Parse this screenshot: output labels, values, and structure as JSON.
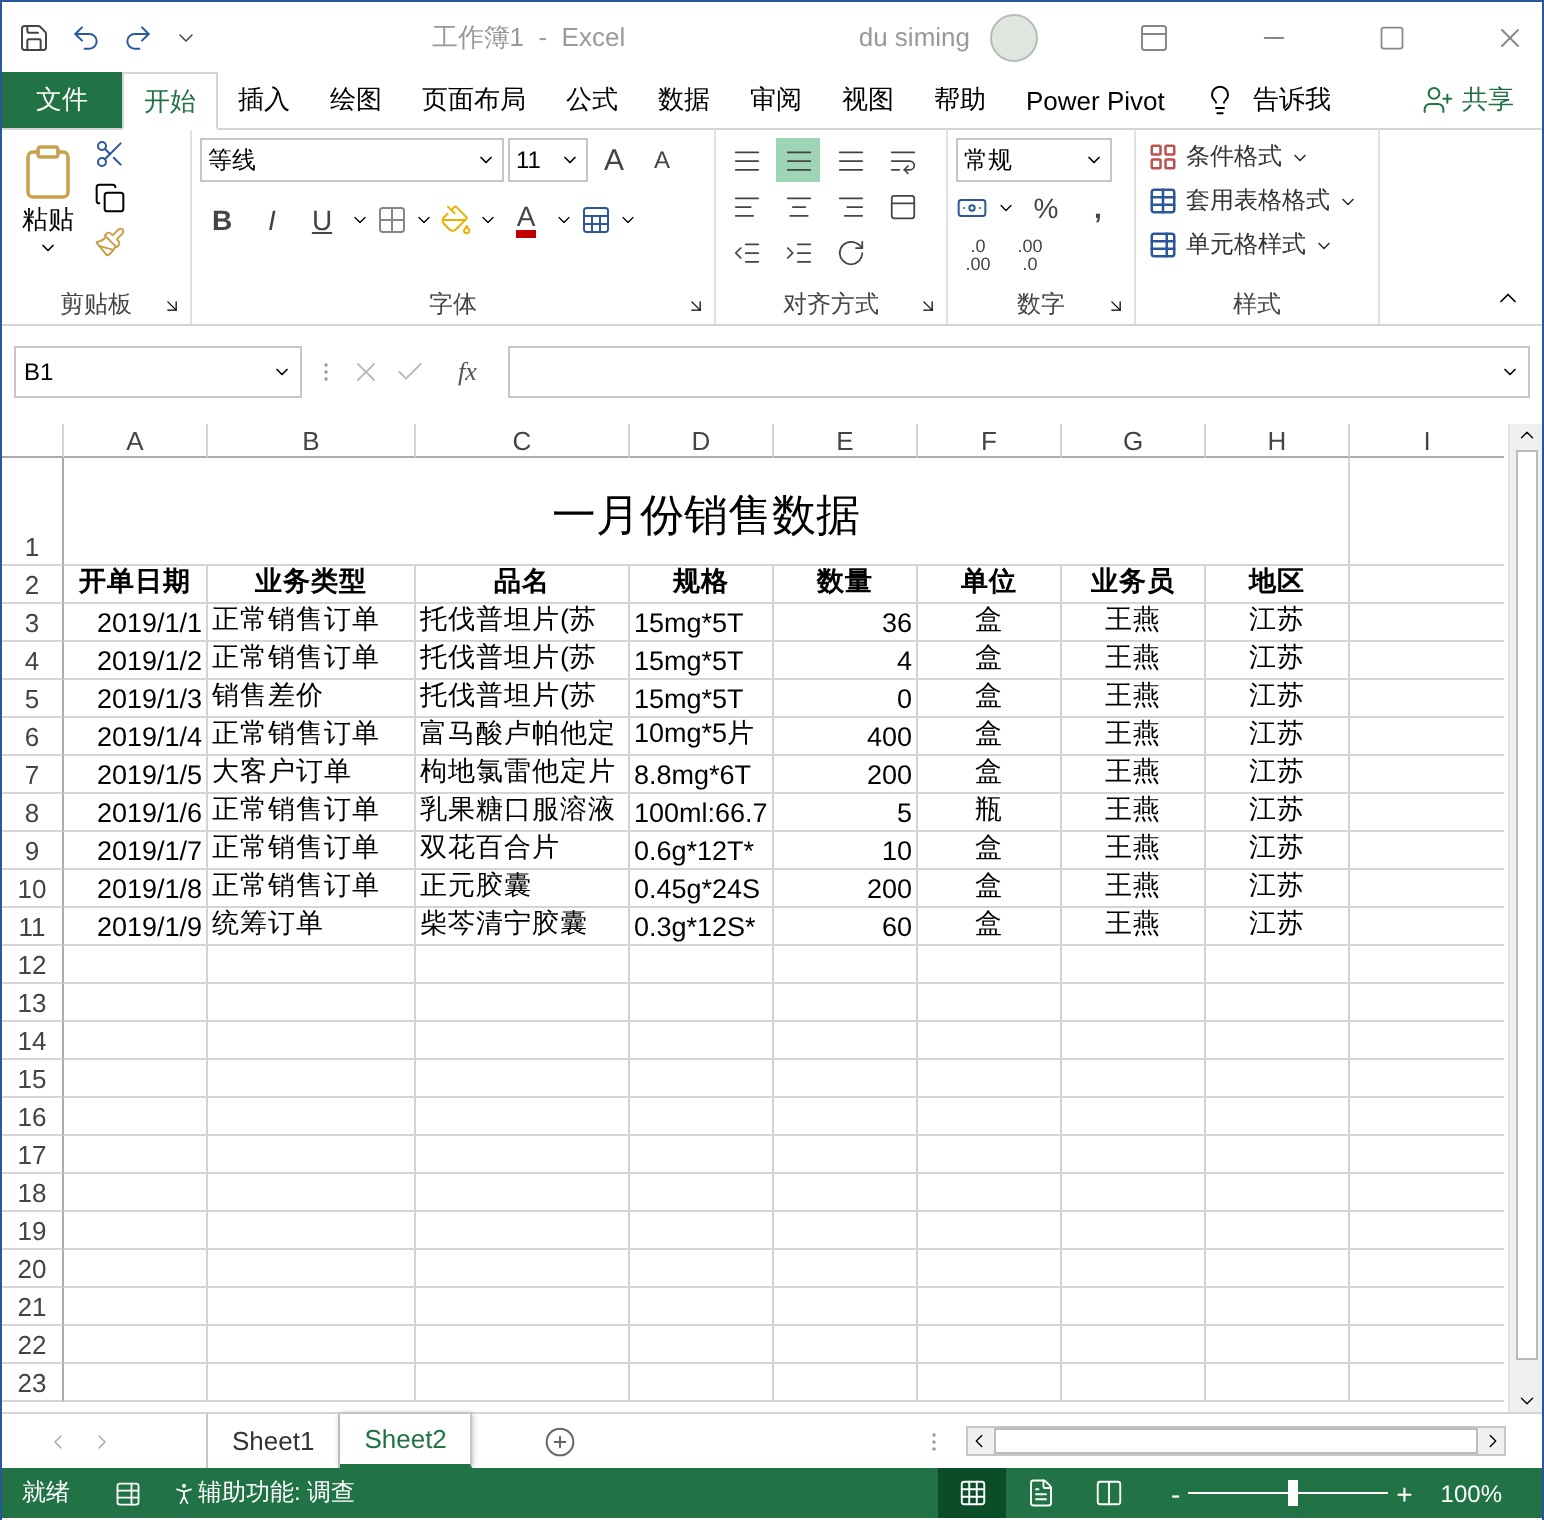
{
  "title_bar": {
    "document_title": "工作簿1  -  Excel",
    "user": "du siming"
  },
  "menu_tabs": [
    {
      "label": "文件",
      "kind": "file",
      "selected": false
    },
    {
      "label": "开始",
      "kind": "tab",
      "selected": true
    },
    {
      "label": "插入",
      "kind": "tab",
      "selected": false
    },
    {
      "label": "绘图",
      "kind": "tab",
      "selected": false
    },
    {
      "label": "页面布局",
      "kind": "tab",
      "selected": false
    },
    {
      "label": "公式",
      "kind": "tab",
      "selected": false
    },
    {
      "label": "数据",
      "kind": "tab",
      "selected": false
    },
    {
      "label": "审阅",
      "kind": "tab",
      "selected": false
    },
    {
      "label": "视图",
      "kind": "tab",
      "selected": false
    },
    {
      "label": "帮助",
      "kind": "tab",
      "selected": false
    },
    {
      "label": "Power Pivot",
      "kind": "tab",
      "selected": false
    }
  ],
  "tell_me": "告诉我",
  "share": "共享",
  "ribbon": {
    "clipboard": {
      "paste": "粘贴",
      "label": "剪贴板"
    },
    "font": {
      "name": "等线",
      "size": "11",
      "grow": "A",
      "shrink": "A",
      "bold": "B",
      "italic": "I",
      "underline": "U",
      "font_color": "A",
      "label": "字体"
    },
    "alignment": {
      "buttons": [
        {
          "kind": "top",
          "selected": false
        },
        {
          "kind": "middle",
          "selected": true
        },
        {
          "kind": "bottom",
          "selected": false
        },
        {
          "kind": "wrap",
          "selected": false
        },
        {
          "kind": "left",
          "selected": false
        },
        {
          "kind": "center",
          "selected": false
        },
        {
          "kind": "right",
          "selected": false
        },
        {
          "kind": "merge",
          "selected": false
        },
        {
          "kind": "outdent",
          "selected": false
        },
        {
          "kind": "indent",
          "selected": false
        },
        {
          "kind": "orientation",
          "selected": false
        }
      ],
      "label": "对齐方式"
    },
    "number": {
      "format": "常规",
      "percent": "%",
      "comma": ",",
      "increase_decimal": [
        ".0",
        ".00"
      ],
      "decrease_decimal": [
        ".00",
        ".0"
      ],
      "label": "数字"
    },
    "styles": {
      "items": [
        "条件格式",
        "套用表格格式",
        "单元格样式"
      ],
      "label": "样式"
    }
  },
  "formula_bar": {
    "name_box": "B1",
    "fx": "fx"
  },
  "sheet": {
    "columns": [
      "A",
      "B",
      "C",
      "D",
      "E",
      "F",
      "G",
      "H",
      "I"
    ],
    "title": "一月份销售数据",
    "headers": [
      "开单日期",
      "业务类型",
      "品名",
      "规格",
      "数量",
      "单位",
      "业务员",
      "地区"
    ],
    "rows": [
      [
        "2019/1/1",
        "正常销售订单",
        "托伐普坦片(苏",
        "15mg*5T",
        "36",
        "盒",
        "王燕",
        "江苏"
      ],
      [
        "2019/1/2",
        "正常销售订单",
        "托伐普坦片(苏",
        "15mg*5T",
        "4",
        "盒",
        "王燕",
        "江苏"
      ],
      [
        "2019/1/3",
        "销售差价",
        "托伐普坦片(苏",
        "15mg*5T",
        "0",
        "盒",
        "王燕",
        "江苏"
      ],
      [
        "2019/1/4",
        "正常销售订单",
        "富马酸卢帕他定",
        "10mg*5片",
        "400",
        "盒",
        "王燕",
        "江苏"
      ],
      [
        "2019/1/5",
        "大客户订单",
        "枸地氯雷他定片",
        "8.8mg*6T",
        "200",
        "盒",
        "王燕",
        "江苏"
      ],
      [
        "2019/1/6",
        "正常销售订单",
        "乳果糖口服溶液",
        "100ml:66.7",
        "5",
        "瓶",
        "王燕",
        "江苏"
      ],
      [
        "2019/1/7",
        "正常销售订单",
        "双花百合片",
        "0.6g*12T*",
        "10",
        "盒",
        "王燕",
        "江苏"
      ],
      [
        "2019/1/8",
        "正常销售订单",
        "正元胶囊",
        "0.45g*24S",
        "200",
        "盒",
        "王燕",
        "江苏"
      ],
      [
        "2019/1/9",
        "统筹订单",
        "柴芩清宁胶囊",
        "0.3g*12S*",
        "60",
        "盒",
        "王燕",
        "江苏"
      ]
    ],
    "row_numbers": [
      "1",
      "2",
      "3",
      "4",
      "5",
      "6",
      "7",
      "8",
      "9",
      "10",
      "11",
      "12",
      "13",
      "14",
      "15",
      "16",
      "17",
      "18",
      "19",
      "20",
      "21",
      "22",
      "23"
    ]
  },
  "sheet_tabs": [
    {
      "label": "Sheet1",
      "selected": false
    },
    {
      "label": "Sheet2",
      "selected": true
    }
  ],
  "status_bar": {
    "status": "就绪",
    "accessibility": "辅助功能: 调查",
    "views": [
      {
        "kind": "normal",
        "selected": true
      },
      {
        "kind": "page_layout",
        "selected": false
      },
      {
        "kind": "page_break",
        "selected": false
      }
    ],
    "zoom_out": "-",
    "zoom_in": "+",
    "zoom_slider": {
      "level": 0.52
    },
    "zoom": "100%"
  }
}
